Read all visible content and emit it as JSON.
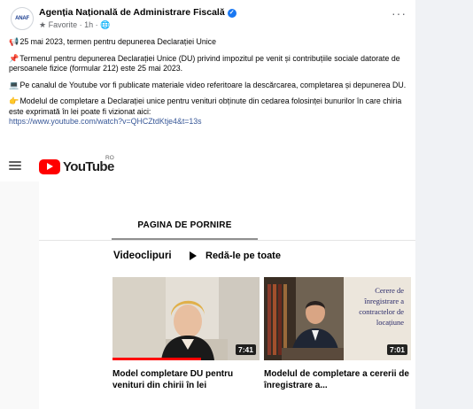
{
  "post": {
    "page_name": "Agenția Națională de Administrare Fiscală",
    "avatar_text": "ANAF",
    "meta": "Favorite · 1h · ",
    "paragraphs": [
      {
        "emoji": "📢",
        "text": "25 mai 2023, termen pentru depunerea Declarației Unice"
      },
      {
        "emoji": "📌",
        "text": "Termenul pentru depunerea Declarației Unice (DU) privind impozitul pe venit și contribuțiile sociale datorate de persoanele fizice (formular 212) este 25 mai 2023."
      },
      {
        "emoji": "💻",
        "text": "Pe canalul de Youtube vor fi publicate materiale video referitoare la descărcarea, completarea și depunerea DU."
      },
      {
        "emoji": "👉",
        "text": "Modelul de completare a Declarației unice pentru venituri obținute din cedarea folosinței bunurilor în care chiria este exprimată în lei poate fi vizionat aici:"
      }
    ],
    "link": "https://www.youtube.com/watch?v=QHCZtdKtje4&t=13s"
  },
  "youtube": {
    "logo_text": "YouTube",
    "region": "RO",
    "tab_home": "PAGINA DE PORNIRE",
    "section_title": "Videoclipuri",
    "play_all": "Redă-le pe toate",
    "videos": [
      {
        "title": "Model completare DU pentru venituri din chirii în lei",
        "duration": "7:41",
        "progress": 0.6
      },
      {
        "title": "Modelul de completare a cererii de înregistrare a...",
        "duration": "7:01",
        "progress": 0.0,
        "overlay_lines": [
          "Cerere de",
          "înregistrare a",
          "contractelor de",
          "locațiune"
        ]
      }
    ]
  },
  "colors": {
    "youtube_red": "#ff0000",
    "facebook_blue": "#1877f2",
    "link": "#385898"
  }
}
